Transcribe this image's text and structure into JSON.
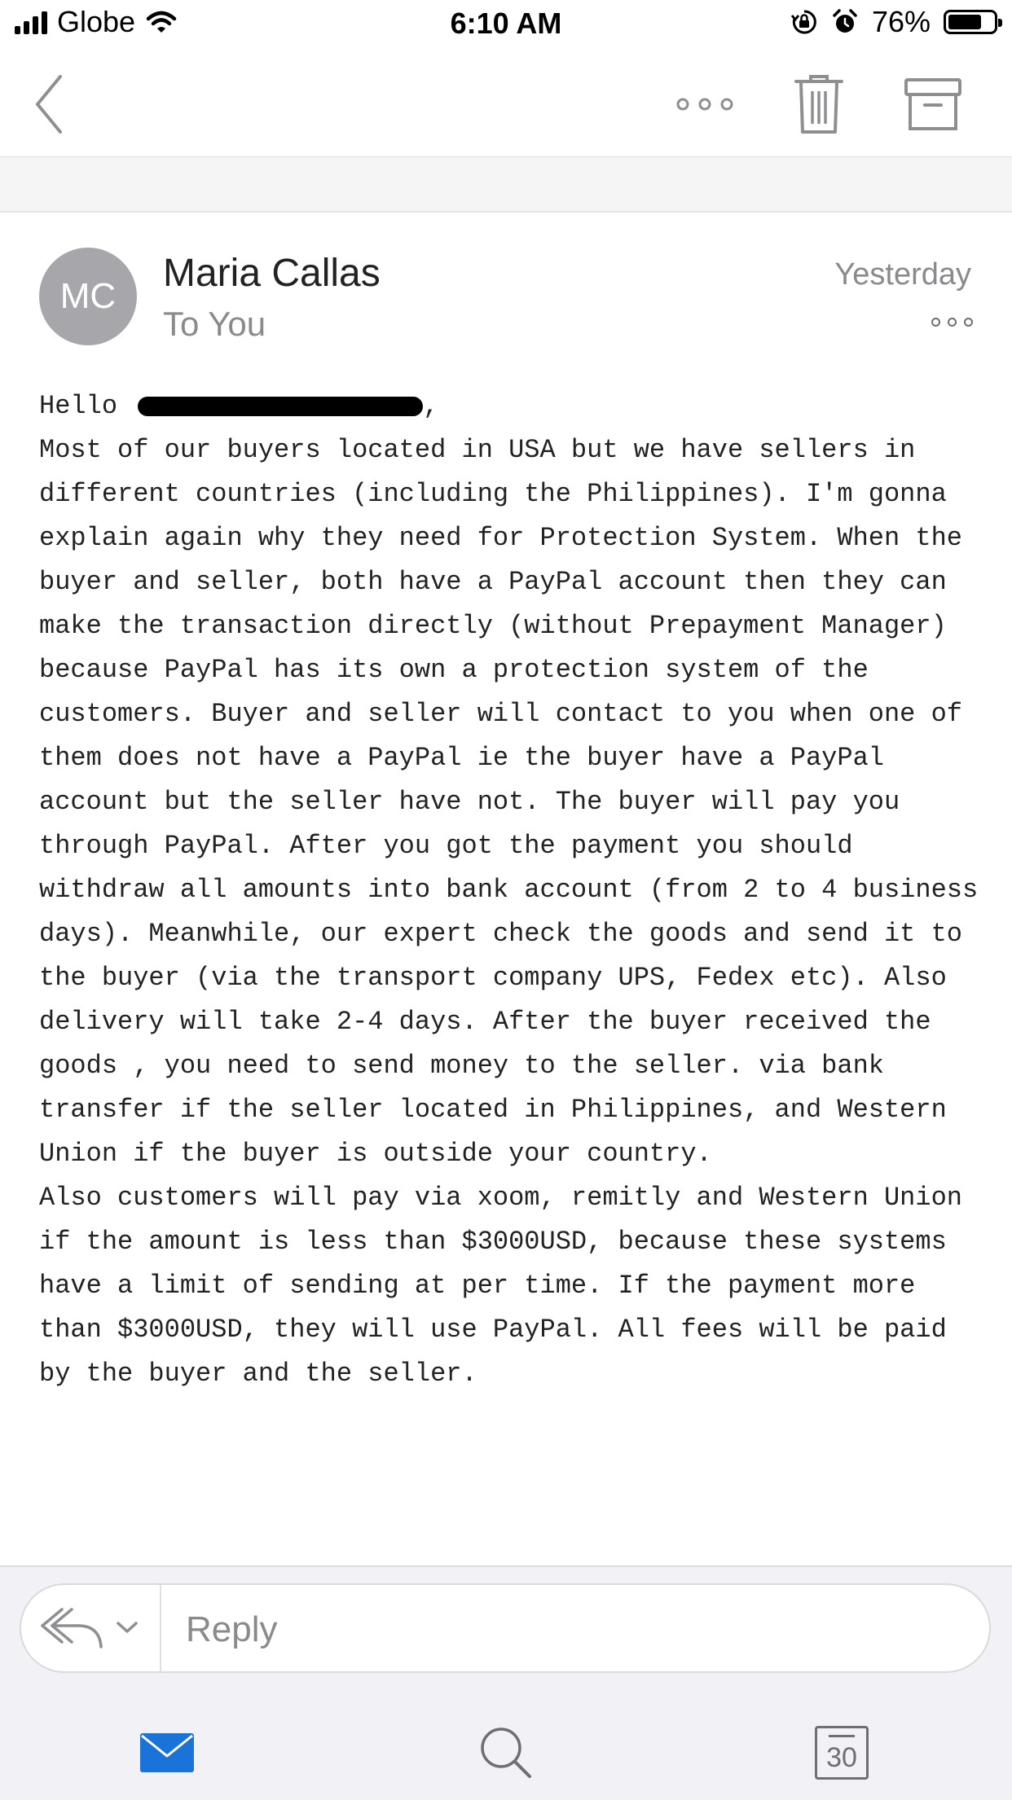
{
  "status_bar": {
    "carrier": "Globe",
    "time": "6:10 AM",
    "battery_percent": "76%",
    "battery_level": 0.76
  },
  "nav": {
    "icons": [
      "back-chevron-icon",
      "more-horizontal-icon",
      "trash-icon",
      "archive-icon"
    ]
  },
  "message": {
    "avatar_initials": "MC",
    "sender": "Maria Callas",
    "recipient": "To You",
    "date": "Yesterday",
    "greeting": "Hello",
    "greeting_suffix": ",",
    "body": "Most of our buyers located in USA but we have sellers in different countries (including the Philippines). I'm gonna explain again why they need for Protection System. When the buyer and seller, both have a PayPal account then they can make the transaction directly (without Prepayment Manager) because PayPal has its own a protection system of the customers. Buyer and seller will contact to you when one of them does not have a PayPal ie the buyer have a PayPal account but the seller have not. The buyer will pay you through PayPal. After you got the payment you should withdraw all amounts into bank account (from 2 to 4 business days). Meanwhile, our expert check the goods and send it to the buyer (via the transport company UPS, Fedex etc). Also delivery will take 2-4 days. After the buyer received the goods , you need to send money to the seller. via bank transfer if the seller located in Philippines, and Western Union if the buyer is outside your country.\nAlso customers will pay via xoom, remitly and Western Union if the amount is less than $3000USD, because these systems have a limit of sending at per time. If the payment more than $3000USD, they will use PayPal. All fees will be paid by the buyer and the seller."
  },
  "reply": {
    "placeholder": "Reply"
  },
  "tab_bar": {
    "calendar_day": "30"
  },
  "colors": {
    "avatar_bg": "#a7a6aa",
    "accent_mail": "#1a73d8",
    "secondary_text": "#8a8a8e"
  }
}
